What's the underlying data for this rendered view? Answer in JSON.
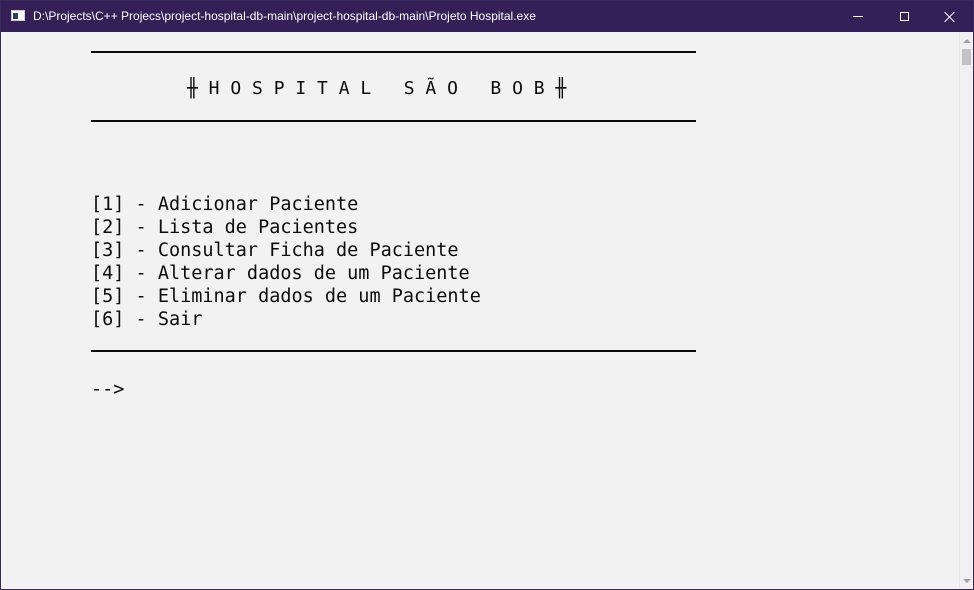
{
  "window": {
    "title": "D:\\Projects\\C++ Projecs\\project-hospital-db-main\\project-hospital-db-main\\Projeto Hospital.exe",
    "titlebar_color": "#341f57",
    "icon": "console-app-icon",
    "controls": {
      "minimize_icon": "minimize-icon",
      "maximize_icon": "maximize-icon",
      "close_icon": "close-icon"
    }
  },
  "console": {
    "background_color": "#f2f2f2",
    "text_color": "#0c0c0c",
    "header_title": "╫ H O S P I T A L   S Ã O   B O B ╫",
    "menu": [
      {
        "label": "[1] - Adicionar Paciente"
      },
      {
        "label": "[2] - Lista de Pacientes"
      },
      {
        "label": "[3] - Consultar Ficha de Paciente"
      },
      {
        "label": "[4] - Alterar dados de um Paciente"
      },
      {
        "label": "[5] - Eliminar dados de um Paciente"
      },
      {
        "label": "[6] - Sair"
      }
    ],
    "prompt": "-->"
  }
}
